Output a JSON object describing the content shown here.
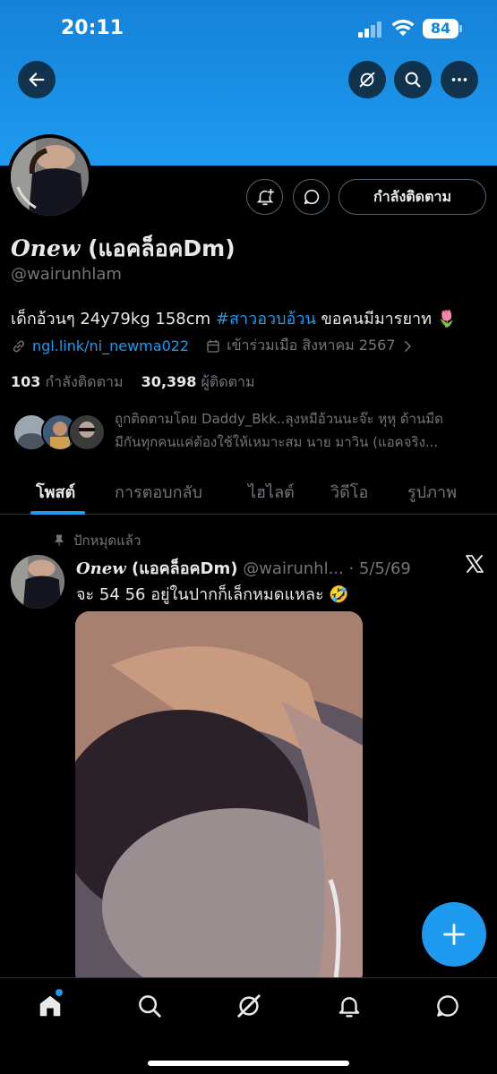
{
  "status_bar": {
    "time": "20:11",
    "battery": "84"
  },
  "profile": {
    "display_name_latin": "Onew",
    "display_name_rest": " (แอคล็อคDm)",
    "handle": "@wairunhlam",
    "bio_text": "เด็กอ้วนๆ 24y79kg 158cm ",
    "bio_hashtag": "#สาวอวบอ้วน",
    "bio_suffix": " ขอคนมีมารยาท 🌷",
    "link": "ngl.link/ni_newma022",
    "joined": "เข้าร่วมเมือ สิงหาคม 2567",
    "following_count": "103",
    "following_label": " กำลังติดตาม",
    "followers_count": "30,398",
    "followers_label": " ผู้ติดตาม",
    "followed_by_line1": "ถูกติดตามโดย Daddy_Bkk..ลุงหมีอ้วนนะจ๊ะ หุหุ ด้านมืด",
    "followed_by_line2": "มีกันทุกคนแค่ต้องใช้ให้เหมาะสม นาย มาวิน (แอคจริง...",
    "follow_button": "กำลังติดตาม"
  },
  "tabs": [
    "โพสต์",
    "การตอบกลับ",
    "ไฮไลต์",
    "วิดีโอ",
    "รูปภาพ"
  ],
  "post": {
    "pinned_label": "ปักหมุดแล้ว",
    "author_latin": "Onew",
    "author_rest": " (แอคล็อคDm)",
    "handle_date": " @wairunhl... · 5/5/69",
    "text": "จะ 54 56 อยู่ในปากก็เล็กหมดแหละ 🤣"
  },
  "colors": {
    "accent": "#1d9bf0",
    "banner": "#1d9bf0",
    "muted": "#71767b"
  }
}
